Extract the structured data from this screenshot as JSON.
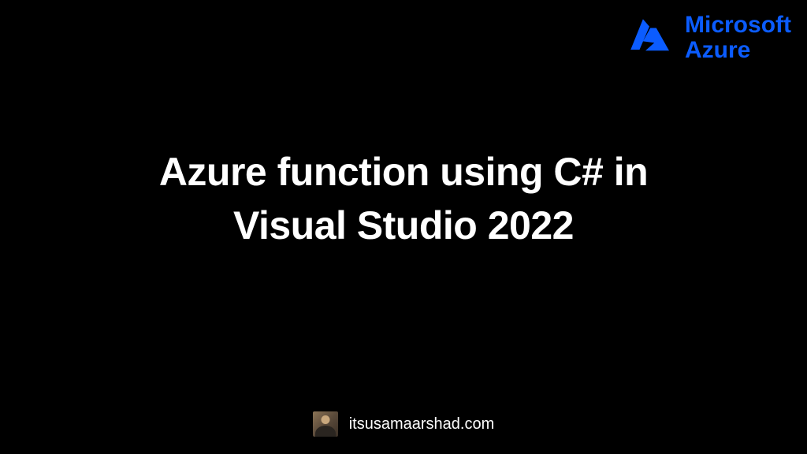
{
  "logo": {
    "line1": "Microsoft",
    "line2": "Azure",
    "color": "#0b5cff"
  },
  "title": {
    "line1": "Azure function using C# in",
    "line2": "Visual Studio 2022"
  },
  "footer": {
    "website": "itsusamaarshad.com"
  }
}
